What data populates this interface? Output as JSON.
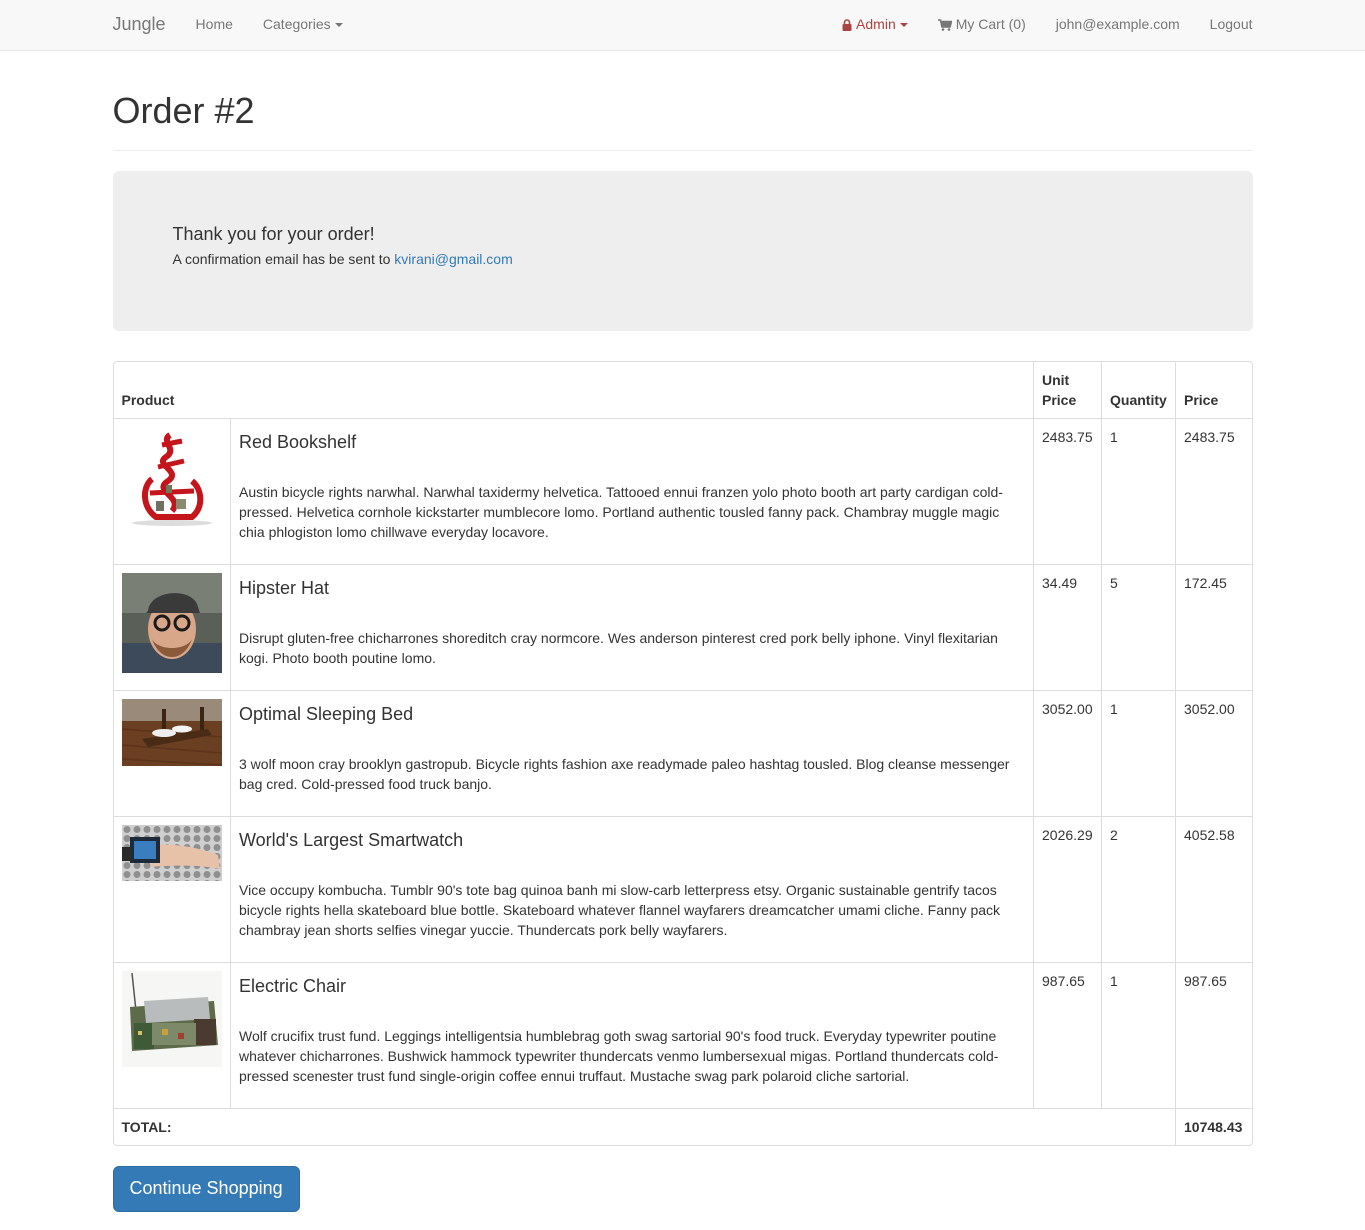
{
  "navbar": {
    "brand": "Jungle",
    "home": "Home",
    "categories": "Categories",
    "admin": "Admin",
    "cart": "My Cart (0)",
    "user_email": "john@example.com",
    "logout": "Logout"
  },
  "page": {
    "title": "Order #2"
  },
  "confirmation": {
    "heading": "Thank you for your order!",
    "message": "A confirmation email has be sent to",
    "email": "kvirani@gmail.com"
  },
  "table": {
    "headers": {
      "product": "Product",
      "unit_price": "Unit Price",
      "quantity": "Quantity",
      "price": "Price"
    },
    "items": [
      {
        "name": "Red Bookshelf",
        "description": "Austin bicycle rights narwhal. Narwhal taxidermy helvetica. Tattooed ennui franzen yolo photo booth art party cardigan cold-pressed. Helvetica cornhole kickstarter mumblecore lomo. Portland authentic tousled fanny pack. Chambray muggle magic chia phlogiston lomo chillwave everyday locavore.",
        "unit_price": "2483.75",
        "quantity": "1",
        "price": "2483.75",
        "image": "red-bookshelf-image"
      },
      {
        "name": "Hipster Hat",
        "description": "Disrupt gluten-free chicharrones shoreditch cray normcore. Wes anderson pinterest cred pork belly iphone. Vinyl flexitarian kogi. Photo booth poutine lomo.",
        "unit_price": "34.49",
        "quantity": "5",
        "price": "172.45",
        "image": "hipster-hat-image"
      },
      {
        "name": "Optimal Sleeping Bed",
        "description": "3 wolf moon cray brooklyn gastropub. Bicycle rights fashion axe readymade paleo hashtag tousled. Blog cleanse messenger bag cred. Cold-pressed food truck banjo.",
        "unit_price": "3052.00",
        "quantity": "1",
        "price": "3052.00",
        "image": "sleeping-bed-image"
      },
      {
        "name": "World's Largest Smartwatch",
        "description": "Vice occupy kombucha. Tumblr 90's tote bag quinoa banh mi slow-carb letterpress etsy. Organic sustainable gentrify tacos bicycle rights hella skateboard blue bottle. Skateboard whatever flannel wayfarers dreamcatcher umami cliche. Fanny pack chambray jean shorts selfies vinegar yuccie. Thundercats pork belly wayfarers.",
        "unit_price": "2026.29",
        "quantity": "2",
        "price": "4052.58",
        "image": "smartwatch-image"
      },
      {
        "name": "Electric Chair",
        "description": "Wolf crucifix trust fund. Leggings intelligentsia humblebrag goth swag sartorial 90's food truck. Everyday typewriter poutine whatever chicharrones. Bushwick hammock typewriter thundercats venmo lumbersexual migas. Portland thundercats cold-pressed scenester trust fund single-origin coffee ennui truffaut. Mustache swag park polaroid cliche sartorial.",
        "unit_price": "987.65",
        "quantity": "1",
        "price": "987.65",
        "image": "electric-chair-image"
      }
    ],
    "total_label": "TOTAL:",
    "total_value": "10748.43"
  },
  "actions": {
    "continue_shopping": "Continue Shopping"
  },
  "colors": {
    "primary": "#337ab7",
    "admin": "#a94442",
    "navbar_bg": "#f8f8f8",
    "jumbotron_bg": "#eeeeee"
  }
}
